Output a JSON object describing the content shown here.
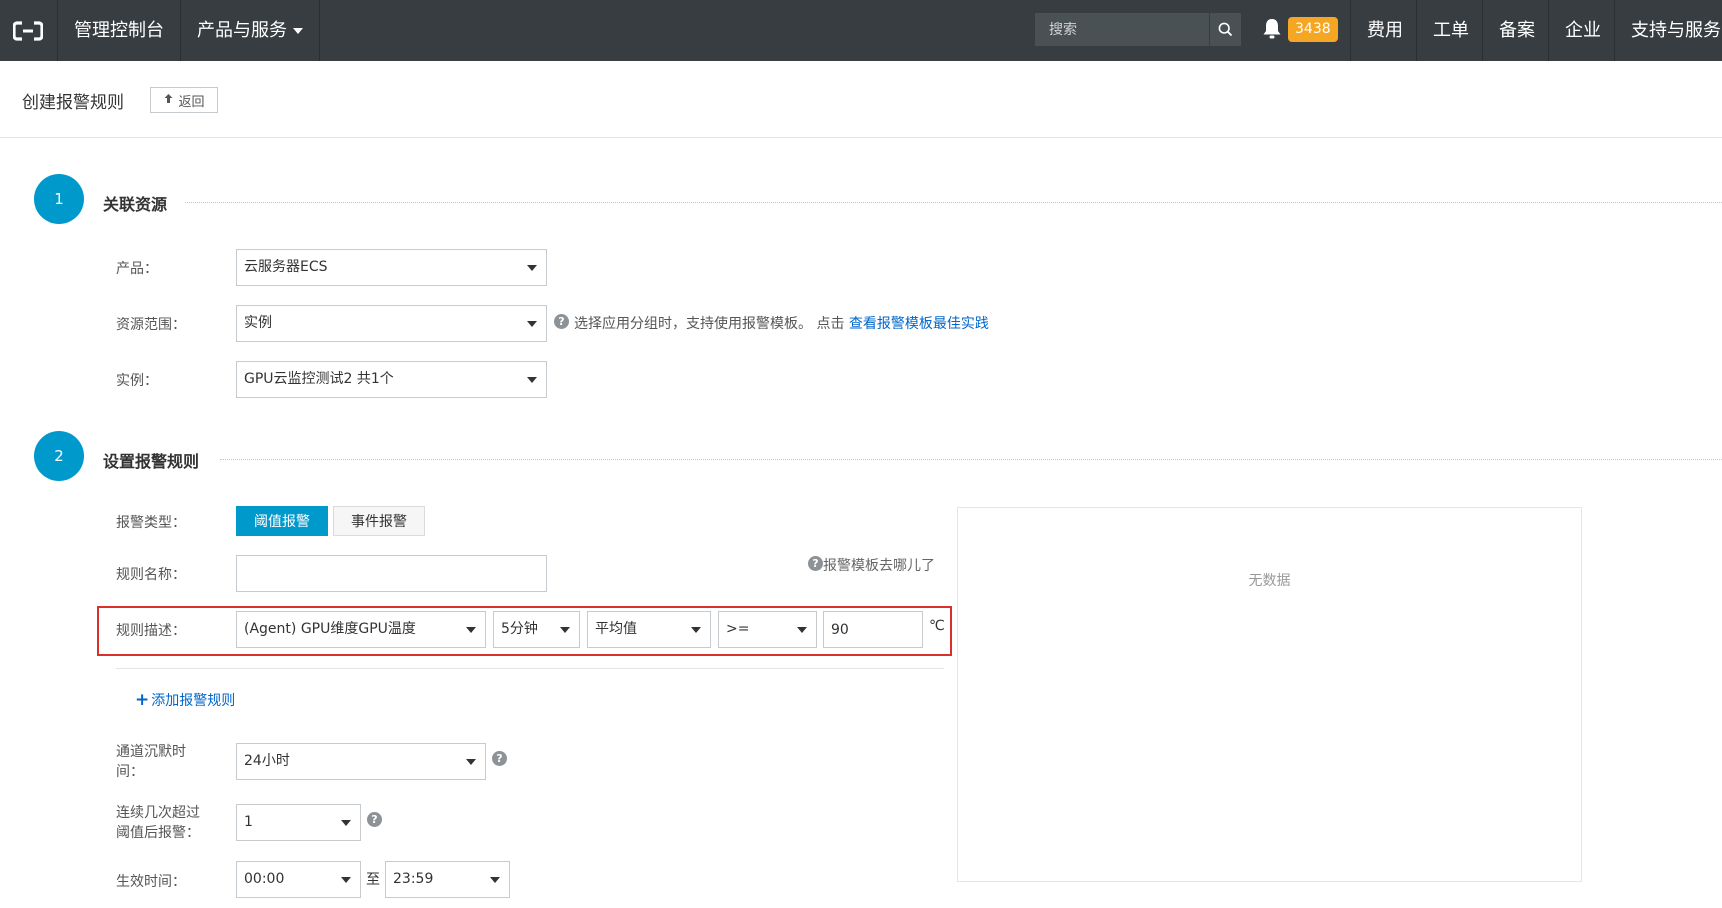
{
  "topbar": {
    "console_label": "管理控制台",
    "products_label": "产品与服务",
    "search_placeholder": "搜索",
    "notification_count": "3438",
    "nav": [
      "费用",
      "工单",
      "备案",
      "企业",
      "支持与服务"
    ]
  },
  "header": {
    "title": "创建报警规则",
    "back_label": "返回"
  },
  "step1": {
    "number": "1",
    "title": "关联资源",
    "product_label": "产品：",
    "product_value": "云服务器ECS",
    "scope_label": "资源范围：",
    "scope_value": "实例",
    "scope_hint": "选择应用分组时，支持使用报警模板。 点击",
    "scope_hint_link": "查看报警模板最佳实践",
    "instance_label": "实例：",
    "instance_value": "GPU云监控测试2 共1个"
  },
  "step2": {
    "number": "2",
    "title": "设置报警规则",
    "alarm_type_label": "报警类型：",
    "alarm_type_threshold": "阈值报警",
    "alarm_type_event": "事件报警",
    "rule_name_label": "规则名称：",
    "rule_name_value": "",
    "template_hint": "报警模板去哪儿了",
    "rule_desc_label": "规则描述：",
    "metric_value": "(Agent) GPU维度GPU温度",
    "period_value": "5分钟",
    "stat_value": "平均值",
    "operator_value": ">=",
    "threshold_value": "90",
    "unit": "℃",
    "add_rule_label": "添加报警规则",
    "silence_label_line1": "通道沉默时",
    "silence_label_line2": "间：",
    "silence_value": "24小时",
    "consecutive_label_line1": "连续几次超过",
    "consecutive_label_line2": "阈值后报警：",
    "consecutive_value": "1",
    "effective_label": "生效时间：",
    "effective_start": "00:00",
    "effective_to": "至",
    "effective_end": "23:59"
  },
  "chart": {
    "no_data": "无数据"
  }
}
